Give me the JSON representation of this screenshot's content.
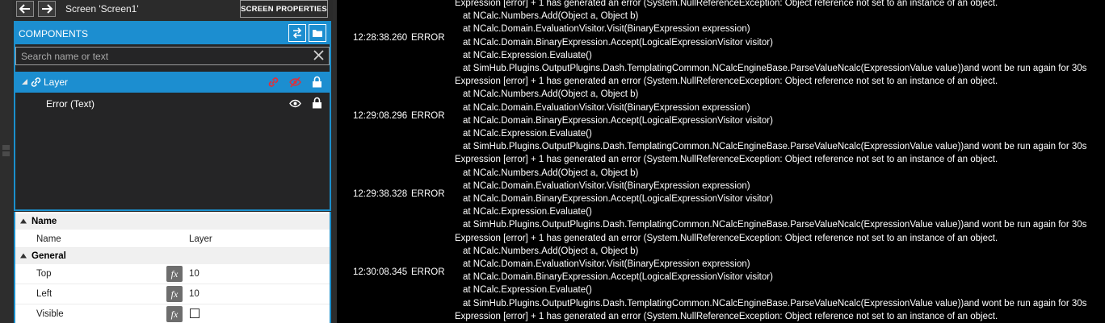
{
  "toolbar": {
    "back_icon": "arrow-left-icon",
    "forward_icon": "arrow-right-icon",
    "screen_title": "Screen 'Screen1'",
    "screen_properties_label": "SCREEN PROPERTIES"
  },
  "components": {
    "title": "COMPONENTS",
    "search_placeholder": "Search name or text",
    "tree": [
      {
        "label": "Layer",
        "icons": [
          "link-icon",
          "link-broken-icon",
          "eye-hidden-icon",
          "lock-icon"
        ]
      },
      {
        "label": "Error   (Text)",
        "icons": [
          "eye-icon",
          "lock-icon"
        ]
      }
    ]
  },
  "properties": {
    "sections": [
      {
        "label": "Name",
        "rows": [
          {
            "label": "Name",
            "value": "Layer"
          }
        ]
      },
      {
        "label": "General",
        "rows": [
          {
            "label": "Top",
            "value": "10"
          },
          {
            "label": "Left",
            "value": "10"
          },
          {
            "label": "Visible",
            "value": ""
          }
        ]
      }
    ],
    "fx_label": "fx"
  },
  "log": {
    "entries": [
      {
        "time": "12:28:38.260",
        "level": "ERROR"
      },
      {
        "time": "12:29:08.296",
        "level": "ERROR"
      },
      {
        "time": "12:29:38.328",
        "level": "ERROR"
      },
      {
        "time": "12:30:08.345",
        "level": "ERROR"
      }
    ],
    "head_line": "Expression [error] + 1 has generated an error (System.NullReferenceException: Object reference not set to an instance of an object.",
    "stack": [
      "at NCalc.Numbers.Add(Object a, Object b)",
      "at NCalc.Domain.EvaluationVisitor.Visit(BinaryExpression expression)",
      "at NCalc.Domain.BinaryExpression.Accept(LogicalExpressionVisitor visitor)",
      "at NCalc.Expression.Evaluate()",
      "at SimHub.Plugins.OutputPlugins.Dash.TemplatingCommon.NCalcEngineBase.ParseValueNcalc(ExpressionValue value))and wont be run again for 30s"
    ]
  },
  "colors": {
    "accent": "#1c8ed0",
    "error_link": "#e0303a"
  }
}
